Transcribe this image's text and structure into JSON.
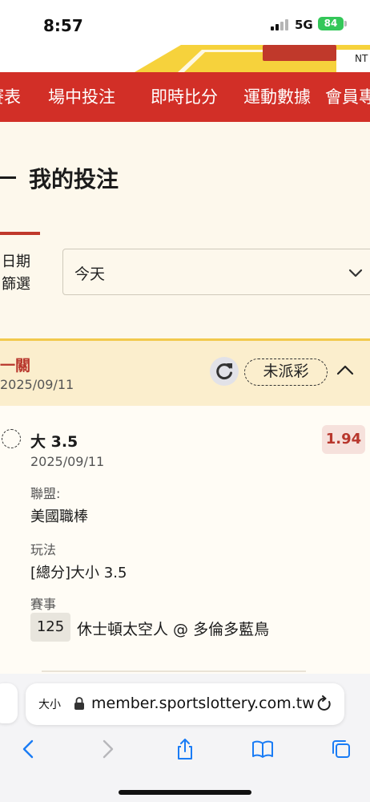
{
  "status_bar": {
    "time": "8:57",
    "network": "5G",
    "battery": "84"
  },
  "banner": {
    "text": "NT"
  },
  "nav": {
    "items": [
      "賽表",
      "場中投注",
      "即時比分",
      "運動數據",
      "會員專區"
    ]
  },
  "page": {
    "title": "我的投注"
  },
  "filter": {
    "label": "日期篩選",
    "selected": "今天"
  },
  "bet_card": {
    "type": "一關",
    "date": "2025/09/11",
    "status": "未派彩",
    "selection": "大 3.5",
    "selection_date": "2025/09/11",
    "odds": "1.94",
    "league_label": "聯盟:",
    "league": "美國職棒",
    "play_label": "玩法",
    "play": "[總分]大小 3.5",
    "event_label": "賽事",
    "event_number": "125",
    "event_name": "休士頓太空人 @ 多倫多藍鳥"
  },
  "browser": {
    "text_size_label": "大小",
    "url": "member.sportslottery.com.tw"
  },
  "colors": {
    "brand_red": "#d22f27",
    "cream": "#fdf8ec",
    "accent_yellow": "#f2c94c",
    "battery_green": "#34c759"
  }
}
